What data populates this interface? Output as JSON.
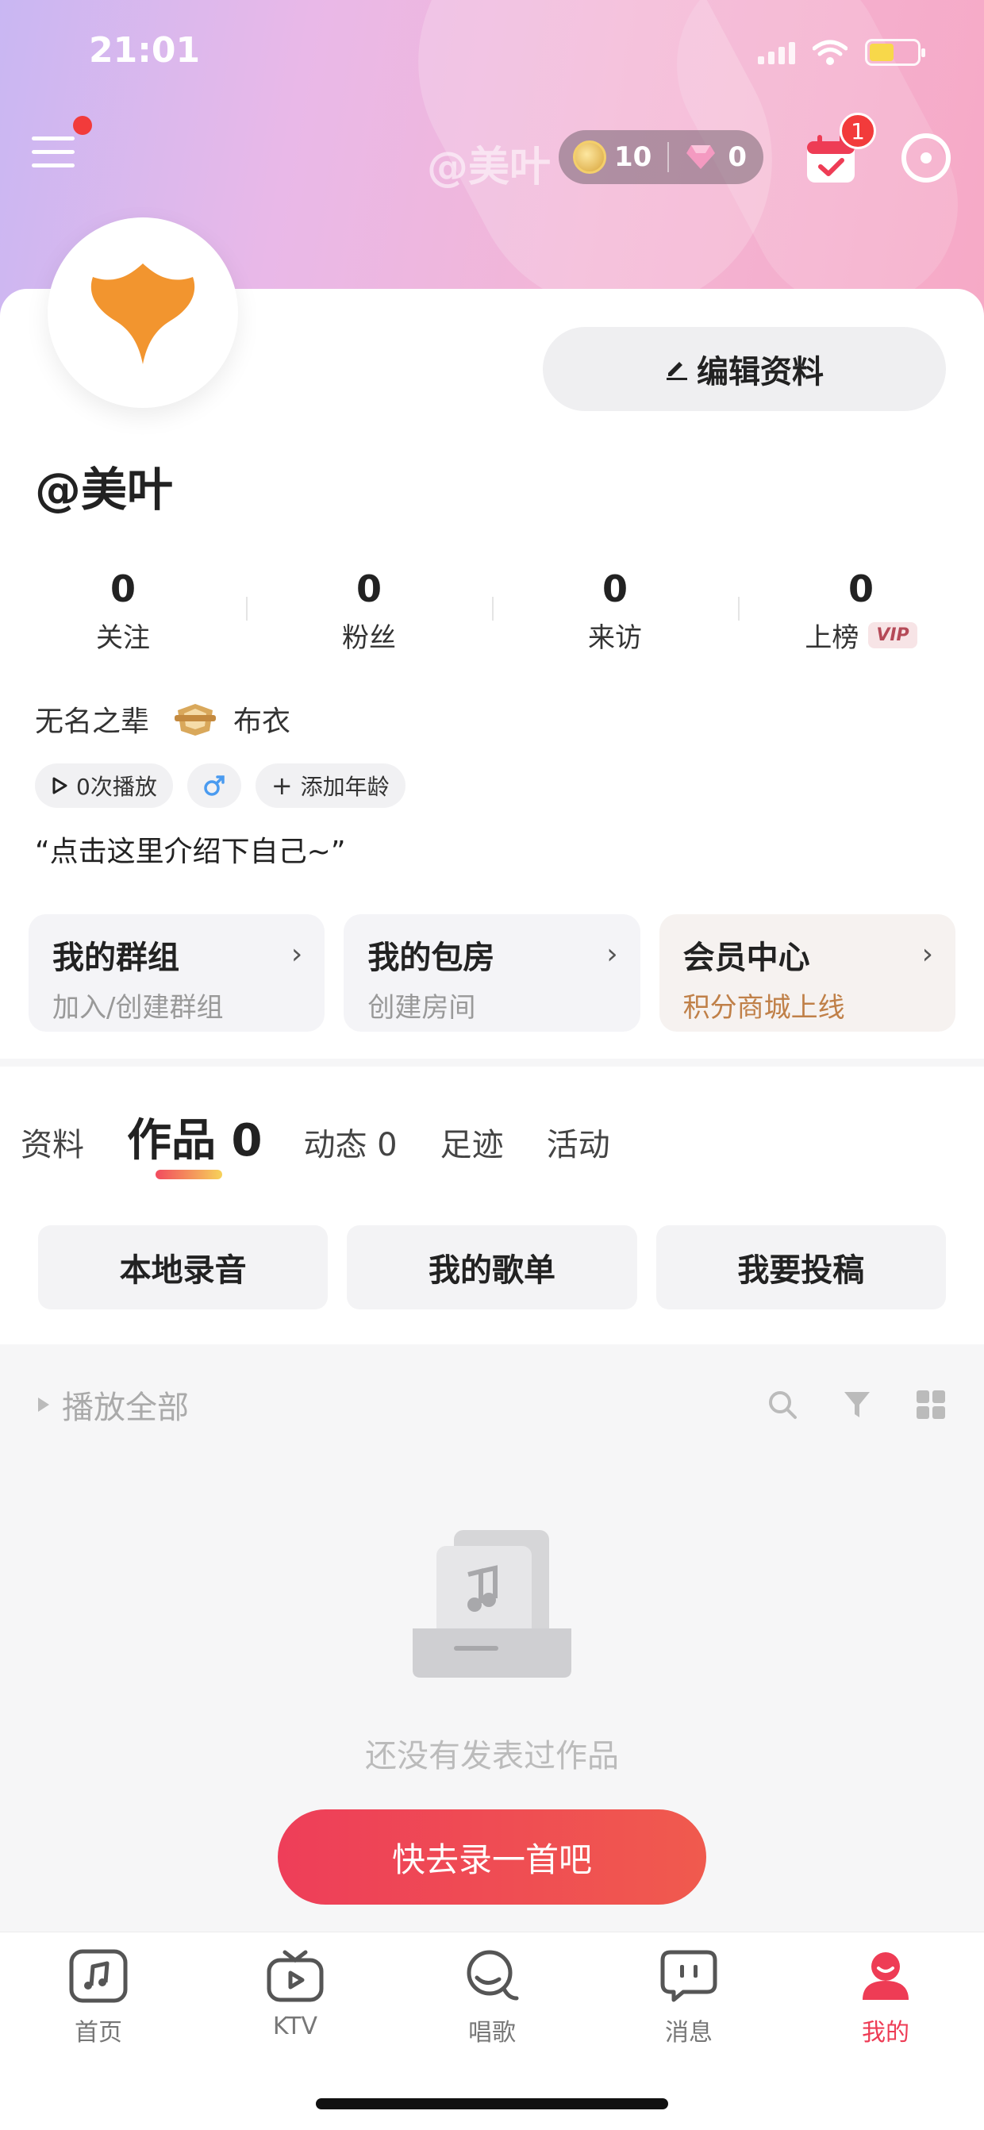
{
  "status_bar": {
    "time": "21:01"
  },
  "header": {
    "ghost_name": "@美叶",
    "coins": "10",
    "diamonds": "0",
    "calendar_badge": "1"
  },
  "profile": {
    "username": "@美叶",
    "edit_label": "编辑资料",
    "stats": [
      {
        "value": "0",
        "label": "关注"
      },
      {
        "value": "0",
        "label": "粉丝"
      },
      {
        "value": "0",
        "label": "来访"
      },
      {
        "value": "0",
        "label": "上榜",
        "badge": "VIP"
      }
    ],
    "rank_title": "无名之辈",
    "rank_level": "布衣",
    "tags": {
      "plays": "0次播放",
      "gender_icon": "male-icon",
      "add_age": "添加年龄"
    },
    "intro": "“点击这里介绍下自己~”"
  },
  "quick_cards": [
    {
      "title": "我的群组",
      "sub": "加入/创建群组"
    },
    {
      "title": "我的包房",
      "sub": "创建房间"
    },
    {
      "title": "会员中心",
      "sub": "积分商城上线"
    }
  ],
  "tabs": [
    {
      "label": "资料"
    },
    {
      "label": "作品 0"
    },
    {
      "label": "动态 0"
    },
    {
      "label": "足迹"
    },
    {
      "label": "活动"
    }
  ],
  "actions": [
    "本地录音",
    "我的歌单",
    "我要投稿"
  ],
  "list": {
    "play_all": "播放全部"
  },
  "empty": {
    "text": "还没有发表过作品",
    "button": "快去录一首吧"
  },
  "bottom_nav": [
    {
      "label": "首页",
      "icon": "music-icon"
    },
    {
      "label": "KTV",
      "icon": "tv-icon"
    },
    {
      "label": "唱歌",
      "icon": "mic-icon"
    },
    {
      "label": "消息",
      "icon": "chat-icon"
    },
    {
      "label": "我的",
      "icon": "user-icon"
    }
  ],
  "colors": {
    "accent": "#ee3c55",
    "vip_text": "#c08048"
  }
}
